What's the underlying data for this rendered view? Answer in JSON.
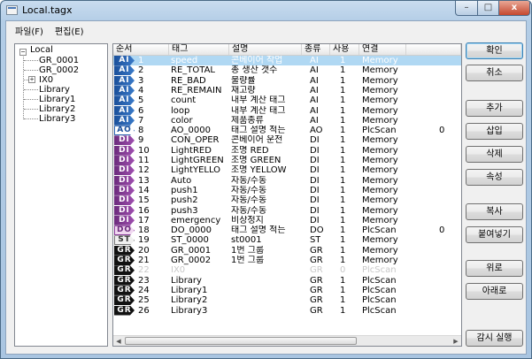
{
  "window": {
    "title": "Local.tagx",
    "controls": {
      "minimize": "–",
      "maximize": "□",
      "close": "x"
    }
  },
  "menu": {
    "items": [
      "파일(F)",
      "편집(E)"
    ]
  },
  "tree": {
    "root": "Local",
    "children": [
      {
        "label": "GR_0001",
        "expander": ""
      },
      {
        "label": "GR_0002",
        "expander": ""
      },
      {
        "label": "IX0",
        "expander": "+"
      },
      {
        "label": "Library",
        "expander": ""
      },
      {
        "label": "Library1",
        "expander": ""
      },
      {
        "label": "Library2",
        "expander": ""
      },
      {
        "label": "Library3",
        "expander": ""
      }
    ]
  },
  "table": {
    "columns": [
      "순서",
      "태그",
      "설명",
      "종류",
      "사용",
      "연결",
      ""
    ],
    "rows": [
      {
        "badge": "AI",
        "no": "1",
        "tag": "speed",
        "desc": "콘베이어 작업",
        "type": "AI",
        "use": "1",
        "link": "Memory",
        "extra": ""
      },
      {
        "badge": "AI",
        "no": "2",
        "tag": "RE_TOTAL",
        "desc": "총 생산 갯수",
        "type": "AI",
        "use": "1",
        "link": "Memory",
        "extra": ""
      },
      {
        "badge": "AI",
        "no": "3",
        "tag": "RE_BAD",
        "desc": "불량률",
        "type": "AI",
        "use": "1",
        "link": "Memory",
        "extra": ""
      },
      {
        "badge": "AI",
        "no": "4",
        "tag": "RE_REMAIN",
        "desc": "재고량",
        "type": "AI",
        "use": "1",
        "link": "Memory",
        "extra": ""
      },
      {
        "badge": "AI",
        "no": "5",
        "tag": "count",
        "desc": "내부 계산 태그",
        "type": "AI",
        "use": "1",
        "link": "Memory",
        "extra": ""
      },
      {
        "badge": "AI",
        "no": "6",
        "tag": "loop",
        "desc": "내부 계산 태그",
        "type": "AI",
        "use": "1",
        "link": "Memory",
        "extra": ""
      },
      {
        "badge": "AI",
        "no": "7",
        "tag": "color",
        "desc": "제품종류",
        "type": "AI",
        "use": "1",
        "link": "Memory",
        "extra": ""
      },
      {
        "badge": "AO",
        "no": "8",
        "tag": "AO_0000",
        "desc": "태그 설명 적는",
        "type": "AO",
        "use": "1",
        "link": "PlcScan",
        "extra": "0"
      },
      {
        "badge": "DI",
        "no": "9",
        "tag": "CON_OPER",
        "desc": "콘베이어 운전",
        "type": "DI",
        "use": "1",
        "link": "Memory",
        "extra": ""
      },
      {
        "badge": "DI",
        "no": "10",
        "tag": "LightRED",
        "desc": "조명 RED",
        "type": "DI",
        "use": "1",
        "link": "Memory",
        "extra": ""
      },
      {
        "badge": "DI",
        "no": "11",
        "tag": "LightGREEN",
        "desc": "조명 GREEN",
        "type": "DI",
        "use": "1",
        "link": "Memory",
        "extra": ""
      },
      {
        "badge": "DI",
        "no": "12",
        "tag": "LightYELLO",
        "desc": "조명 YELLOW",
        "type": "DI",
        "use": "1",
        "link": "Memory",
        "extra": ""
      },
      {
        "badge": "DI",
        "no": "13",
        "tag": "Auto",
        "desc": "자동/수동",
        "type": "DI",
        "use": "1",
        "link": "Memory",
        "extra": ""
      },
      {
        "badge": "DI",
        "no": "14",
        "tag": "push1",
        "desc": "자동/수동",
        "type": "DI",
        "use": "1",
        "link": "Memory",
        "extra": ""
      },
      {
        "badge": "DI",
        "no": "15",
        "tag": "push2",
        "desc": "자동/수동",
        "type": "DI",
        "use": "1",
        "link": "Memory",
        "extra": ""
      },
      {
        "badge": "DI",
        "no": "16",
        "tag": "push3",
        "desc": "자동/수동",
        "type": "DI",
        "use": "1",
        "link": "Memory",
        "extra": ""
      },
      {
        "badge": "DI",
        "no": "17",
        "tag": "emergency",
        "desc": "비상정지",
        "type": "DI",
        "use": "1",
        "link": "Memory",
        "extra": ""
      },
      {
        "badge": "DO",
        "no": "18",
        "tag": "DO_0000",
        "desc": "태그 설명 적는",
        "type": "DO",
        "use": "1",
        "link": "PlcScan",
        "extra": "0"
      },
      {
        "badge": "ST",
        "no": "19",
        "tag": "ST_0000",
        "desc": "st0001",
        "type": "ST",
        "use": "1",
        "link": "Memory",
        "extra": ""
      },
      {
        "badge": "GR",
        "no": "20",
        "tag": "GR_0001",
        "desc": "1번 그룹",
        "type": "GR",
        "use": "1",
        "link": "Memory",
        "extra": ""
      },
      {
        "badge": "GR",
        "no": "21",
        "tag": "GR_0002",
        "desc": "1번 그룹",
        "type": "GR",
        "use": "1",
        "link": "Memory",
        "extra": ""
      },
      {
        "badge": "GR",
        "no": "22",
        "tag": "IX0",
        "desc": "",
        "type": "GR",
        "use": "0",
        "link": "PlcScan",
        "extra": ""
      },
      {
        "badge": "GR",
        "no": "23",
        "tag": "Library",
        "desc": "",
        "type": "GR",
        "use": "1",
        "link": "PlcScan",
        "extra": ""
      },
      {
        "badge": "GR",
        "no": "24",
        "tag": "Library1",
        "desc": "",
        "type": "GR",
        "use": "1",
        "link": "PlcScan",
        "extra": ""
      },
      {
        "badge": "GR",
        "no": "25",
        "tag": "Library2",
        "desc": "",
        "type": "GR",
        "use": "1",
        "link": "PlcScan",
        "extra": ""
      },
      {
        "badge": "GR",
        "no": "26",
        "tag": "Library3",
        "desc": "",
        "type": "GR",
        "use": "1",
        "link": "PlcScan",
        "extra": ""
      }
    ],
    "selected_row": 0,
    "dimmed_row": 21
  },
  "scroll": {
    "left_arrow": "◀",
    "right_arrow": "▶"
  },
  "buttons": {
    "ok": "확인",
    "cancel": "취소",
    "add": "추가",
    "insert": "삽입",
    "delete": "삭제",
    "properties": "속성",
    "copy": "복사",
    "paste": "붙여넣기",
    "up": "위로",
    "down": "아래로",
    "monitor": "감시 실행"
  },
  "colors": {
    "selection": "#b0d8f3",
    "title_gradient": "#b3cde6",
    "close_button": "#c4482f"
  }
}
